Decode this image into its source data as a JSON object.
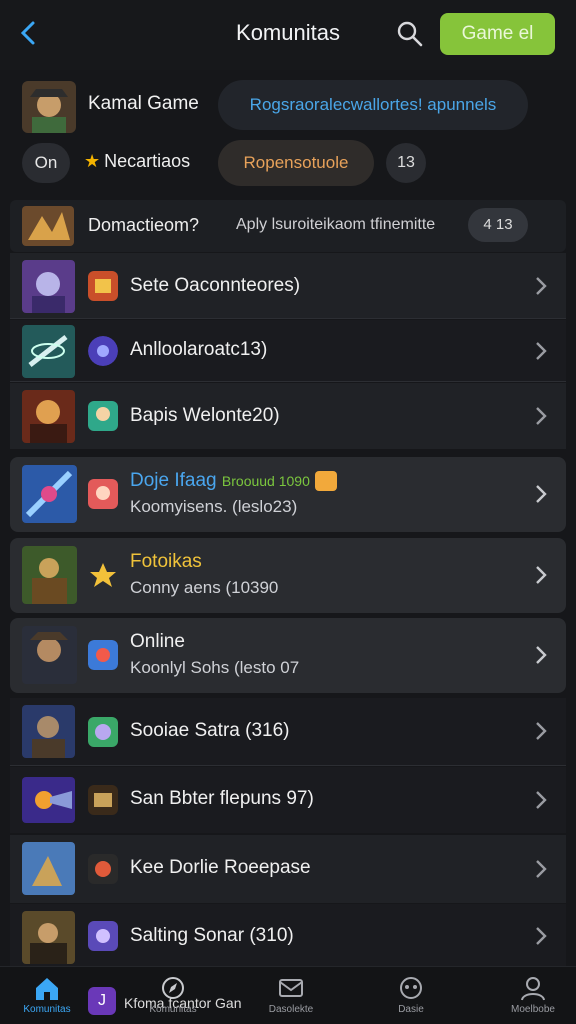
{
  "header": {
    "title": "Komunitas",
    "game_button": "Game el"
  },
  "profile": {
    "name": "Kamal Game",
    "pill": "Rogsraoralecwallortes! apunnels"
  },
  "chips": {
    "on": "On",
    "favorites": "Necartiaos",
    "sort": "Ropensotuole",
    "count": "13"
  },
  "summary": {
    "title": "Domactieom?",
    "text": "Aply lsuroiteikaom tfinemitte",
    "badge": "4 13"
  },
  "items": [
    {
      "title": "Sete Oaconnteores)",
      "subtitle": ""
    },
    {
      "title": "Anlloolaroatc13)",
      "subtitle": ""
    },
    {
      "title": "Bapis Welonte20)",
      "subtitle": ""
    },
    {
      "title": "Doje Ifaag",
      "tag": "Broouud 1090",
      "subtitle": "Koomyisens. (leslo23)"
    },
    {
      "title": "Fotoikas",
      "subtitle": "Conny aens (10390"
    },
    {
      "title": "Online",
      "subtitle": "Koonlyl Sohs (lesto 07"
    },
    {
      "title": "Sooiae Satra (316)",
      "subtitle": ""
    },
    {
      "title": "San Bbter flepuns 97)",
      "subtitle": ""
    },
    {
      "title": "Kee Dorlie Roeepase",
      "subtitle": ""
    },
    {
      "title": "Salting Sonar (310)",
      "subtitle": ""
    }
  ],
  "nav": {
    "home": "Komunitas",
    "app_text": "Kfoma fcantor Gan",
    "items": [
      "Komunitas",
      "Dasolekte",
      "Dasie",
      "Moelbobe"
    ]
  },
  "colors": {
    "accent_blue": "#3ba7f5",
    "accent_green": "#86c43a",
    "background": "#16171a"
  }
}
